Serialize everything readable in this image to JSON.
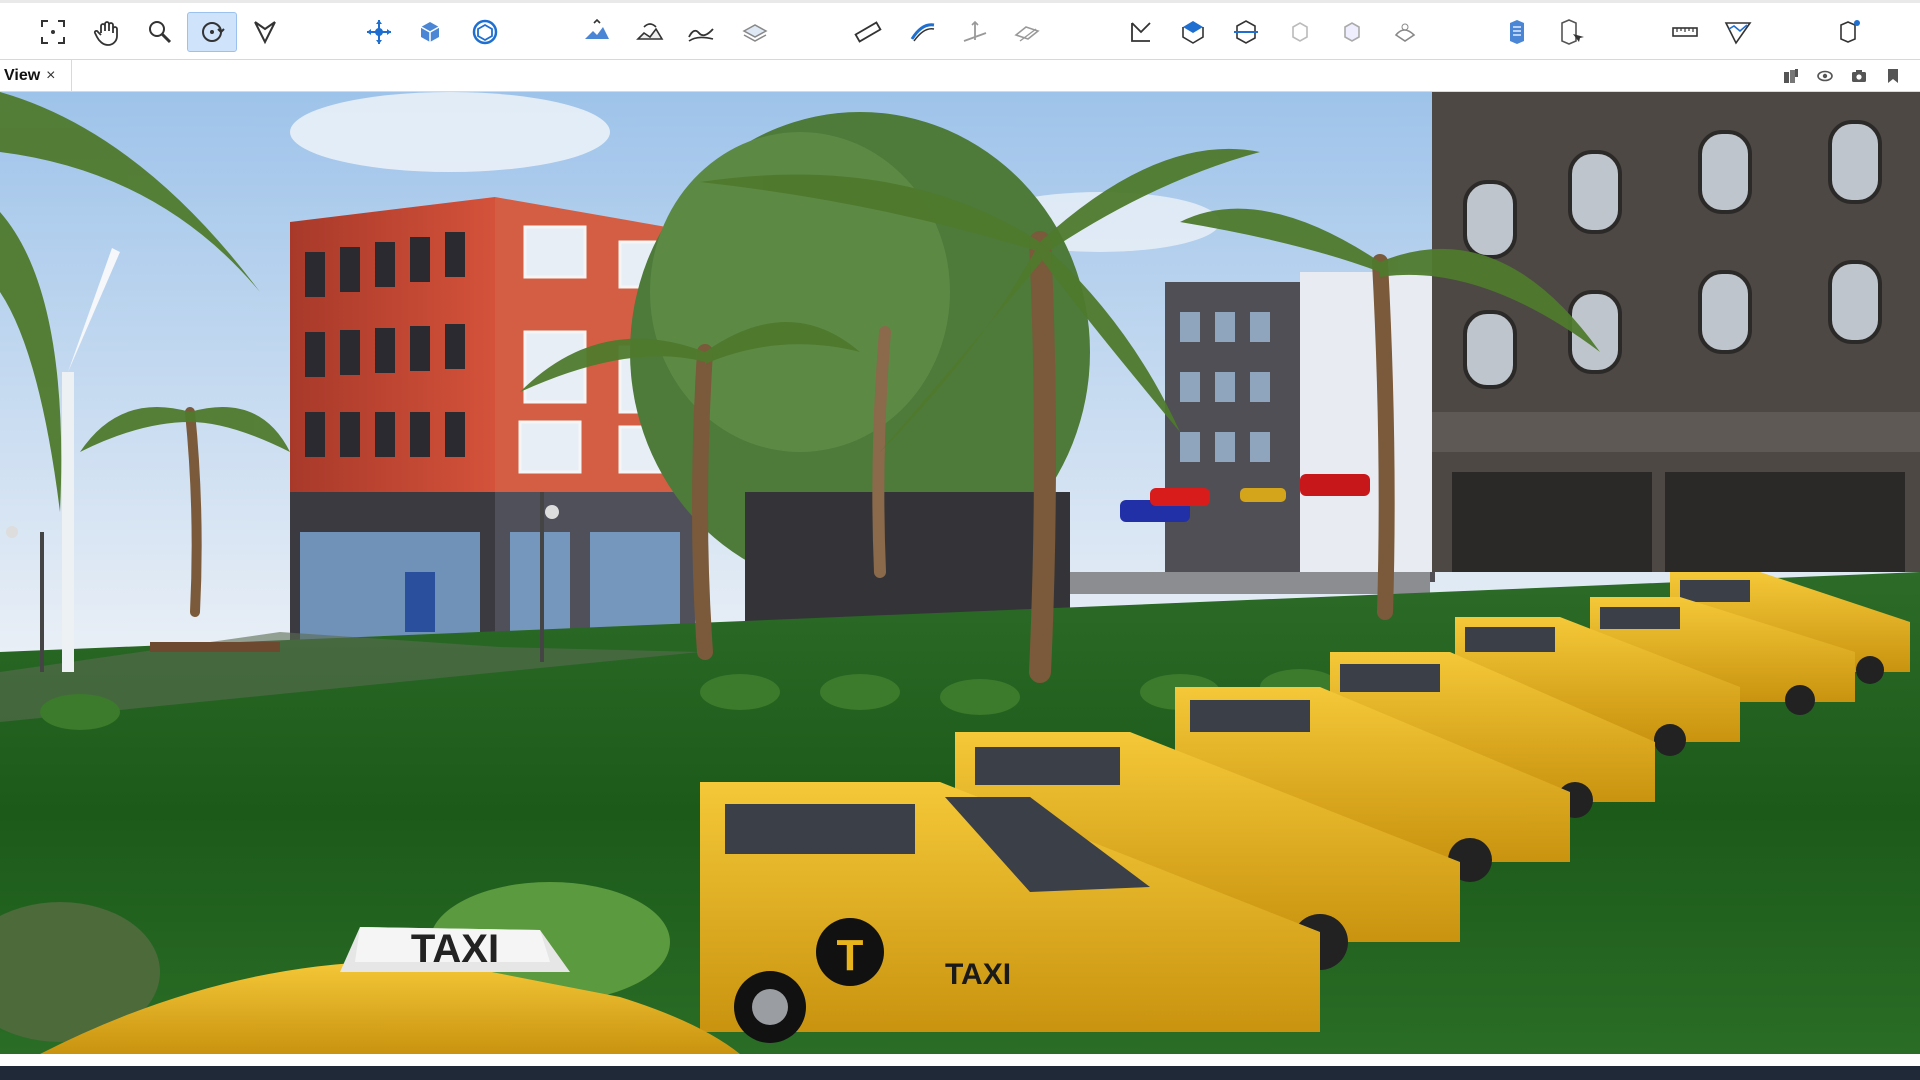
{
  "toolbar": {
    "buttons": [
      {
        "name": "zoom-extents-icon"
      },
      {
        "name": "pan-hand-icon"
      },
      {
        "name": "zoom-icon"
      },
      {
        "name": "orbit-icon",
        "active": true
      },
      {
        "name": "walk-icon"
      },
      {
        "name": "move-gizmo-icon"
      },
      {
        "name": "box-view-icon"
      },
      {
        "name": "sphere-view-icon"
      },
      {
        "name": "terrain-cut-icon"
      },
      {
        "name": "terrain-raise-icon"
      },
      {
        "name": "terrain-smooth-icon"
      },
      {
        "name": "terrain-flatten-icon"
      },
      {
        "name": "measure-distance-icon"
      },
      {
        "name": "measure-path-icon"
      },
      {
        "name": "measure-height-icon"
      },
      {
        "name": "measure-area-icon"
      },
      {
        "name": "section-plane-icon"
      },
      {
        "name": "clip-box-icon"
      },
      {
        "name": "clip-volume-icon"
      },
      {
        "name": "hide-object-icon"
      },
      {
        "name": "isolate-object-icon"
      },
      {
        "name": "explode-object-icon"
      },
      {
        "name": "building-model-icon"
      },
      {
        "name": "building-select-icon"
      },
      {
        "name": "ruler-icon"
      },
      {
        "name": "profile-icon"
      },
      {
        "name": "network-3d-icon"
      }
    ]
  },
  "tabs": {
    "view_label": "View",
    "close_glyph": "×"
  },
  "right_icons": [
    "layers-icon",
    "visibility-icon",
    "screenshot-icon",
    "bookmark-icon"
  ],
  "scene": {
    "taxi_sign": "TAXI",
    "van_label": "TAXI",
    "van_logo": "T",
    "colors": {
      "sky": "#cfe0f2",
      "grass": "#1f5a1d",
      "taxi_yellow": "#e8b41c",
      "brick": "#c9452f"
    }
  }
}
